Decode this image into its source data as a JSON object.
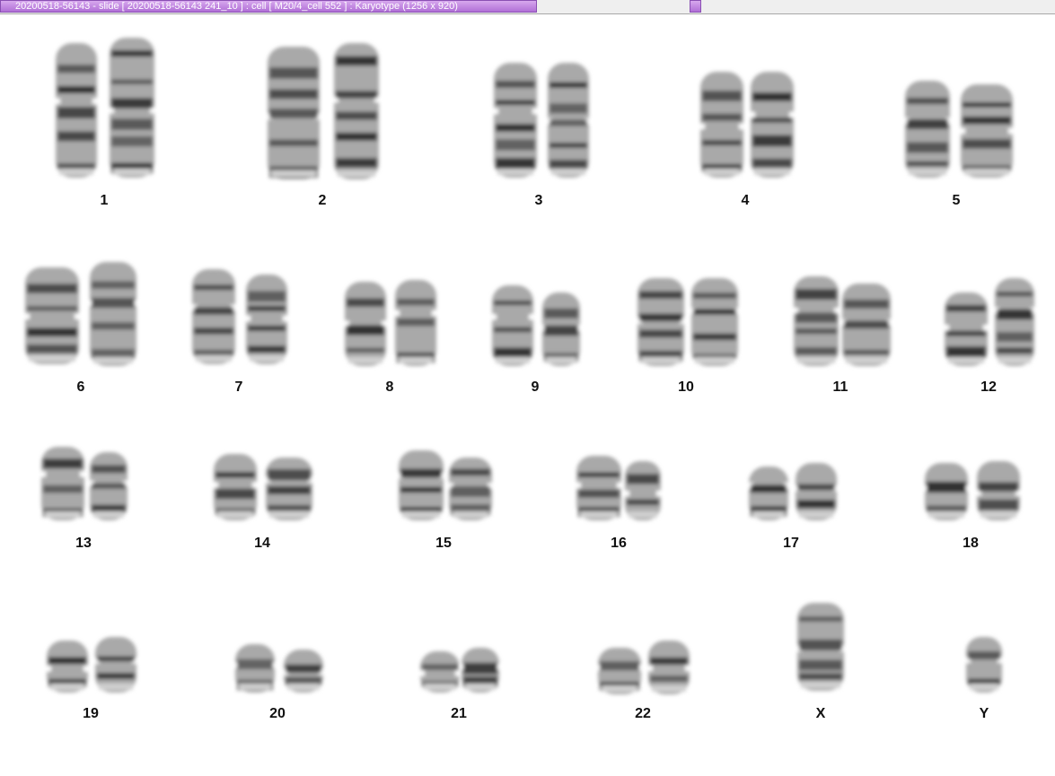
{
  "window": {
    "title": "20200518-56143 - slide [ 20200518-56143 241_10 ] : cell [ M20/4_cell 552 ] : Karyotype  (1256 x 920)"
  },
  "karyotype": {
    "labels": [
      "1",
      "2",
      "3",
      "4",
      "5",
      "6",
      "7",
      "8",
      "9",
      "10",
      "11",
      "12",
      "13",
      "14",
      "15",
      "16",
      "17",
      "18",
      "19",
      "20",
      "21",
      "22",
      "X",
      "Y"
    ]
  }
}
